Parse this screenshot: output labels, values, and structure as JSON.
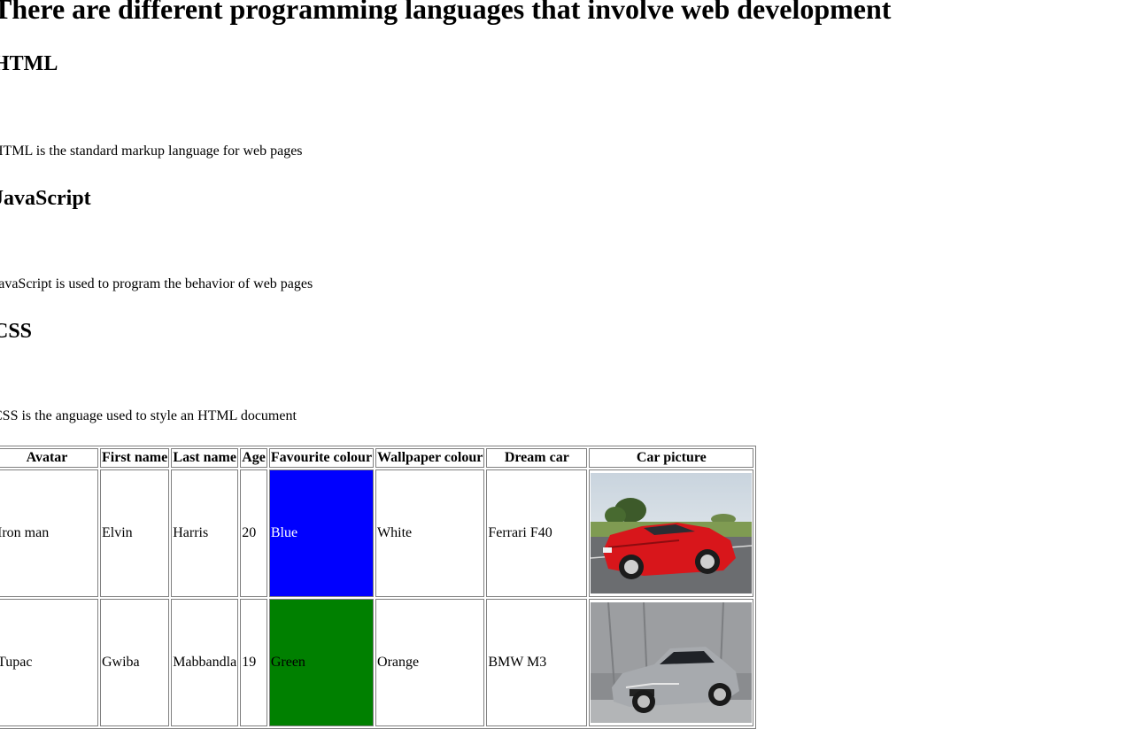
{
  "heading": "There are different programming languages that involve web development",
  "sections": [
    {
      "title": "HTML",
      "text": "HTML is the standard markup language for web pages"
    },
    {
      "title": "JavaScript",
      "text": "JavaScript is used to program the behavior of web pages"
    },
    {
      "title": "CSS",
      "text": "CSS is the anguage used to style an HTML document"
    }
  ],
  "table": {
    "headers": [
      "Avatar",
      "First name",
      "Last name",
      "Age",
      "Favourite colour",
      "Wallpaper colour",
      "Dream car",
      "Car picture"
    ],
    "rows": [
      {
        "avatar": "Iron man",
        "first": "Elvin",
        "last": "Harris",
        "age": "20",
        "fav": "Blue",
        "fav_bg": "#0000ff",
        "fav_fg": "#ffffff",
        "wallpaper": "White",
        "car": "Ferrari F40",
        "car_picture": "red-sports-car-image"
      },
      {
        "avatar": "Tupac",
        "first": "Gwiba",
        "last": "Mabbandla",
        "age": "19",
        "fav": "Green",
        "fav_bg": "#008000",
        "fav_fg": "#000000",
        "wallpaper": "Orange",
        "car": "BMW M3",
        "car_picture": "silver-sports-car-image"
      }
    ]
  }
}
